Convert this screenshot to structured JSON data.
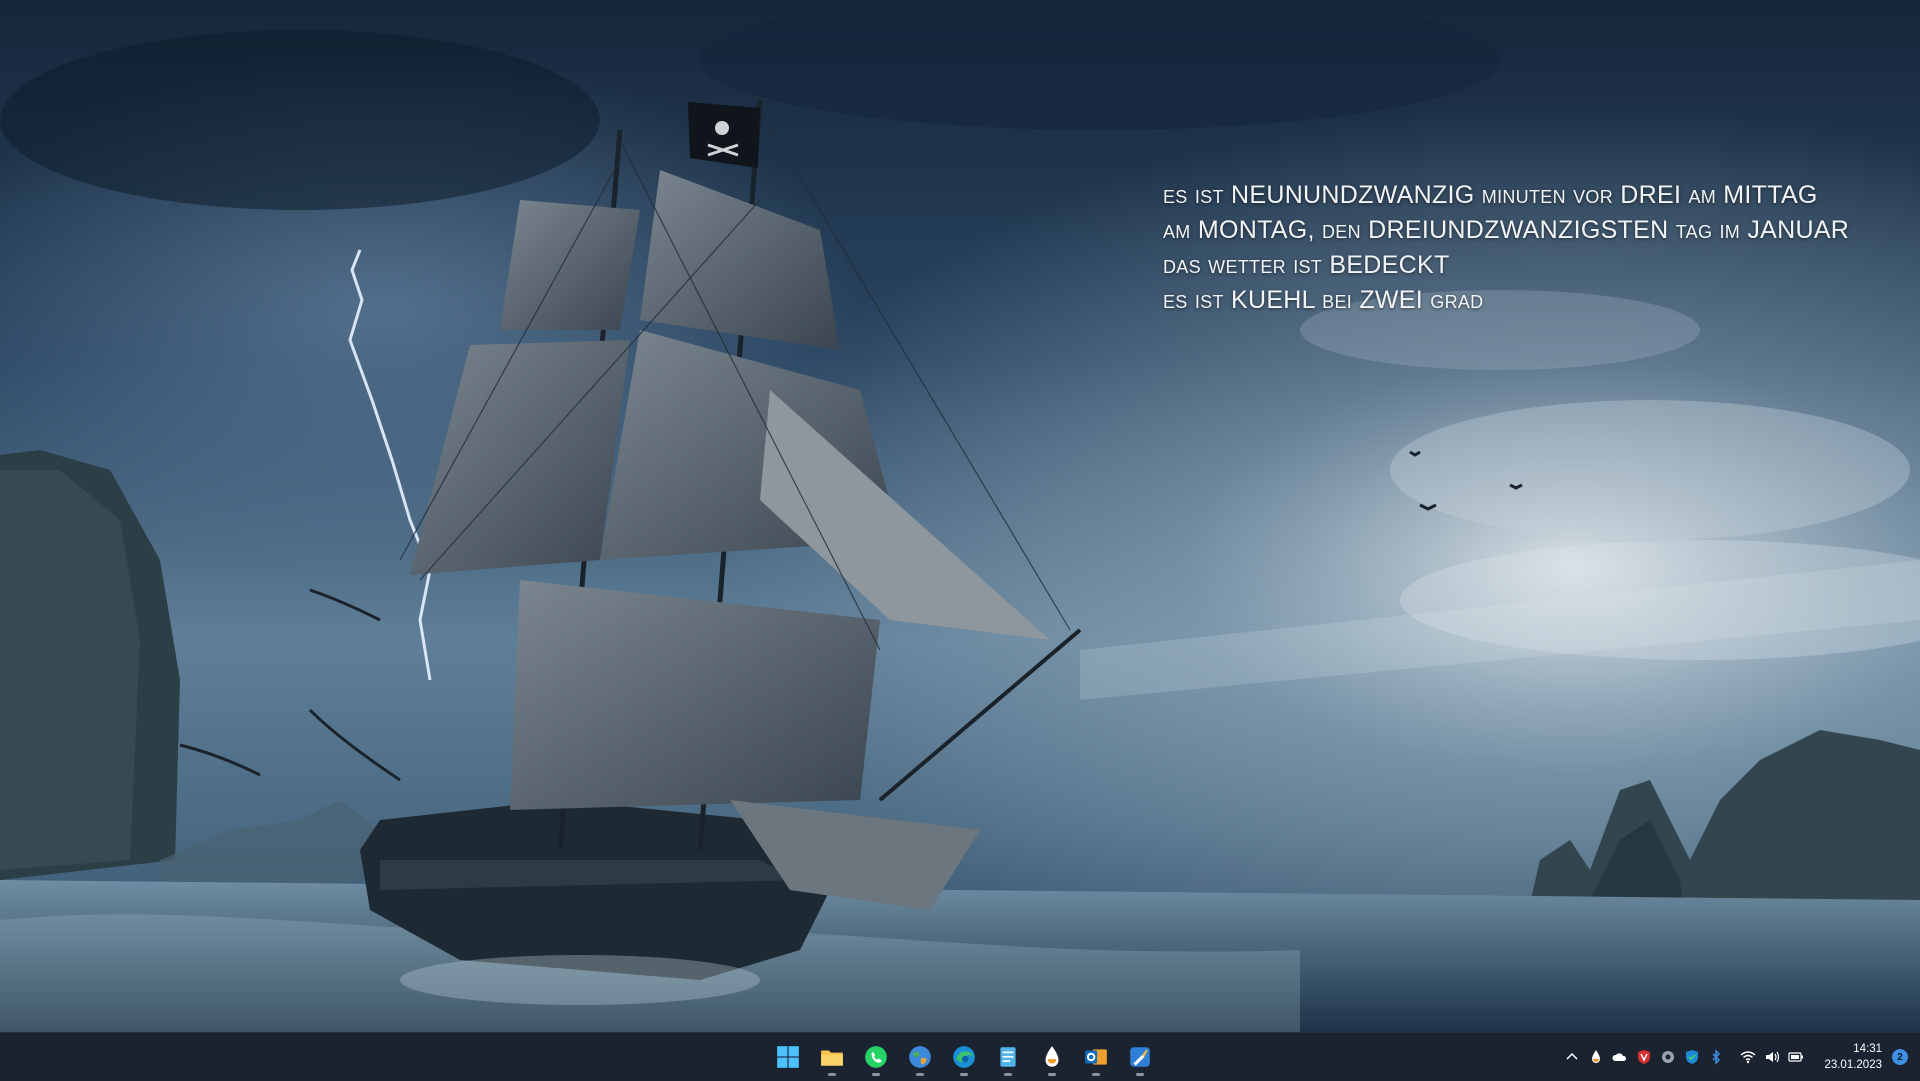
{
  "overlay": {
    "line1": "es ist NEUNUNDZWANZIG minuten vor DREI am MITTAG",
    "line2": "am MONTAG, den DREIUNDZWANZIGSTEN tag im JANUAR",
    "line3": "das wetter ist BEDECKT",
    "line4": "es ist KUEHL bei ZWEI grad"
  },
  "taskbar": {
    "pinned": [
      {
        "name": "start",
        "icon": "windows-logo-icon"
      },
      {
        "name": "file-explorer",
        "icon": "folder-icon"
      },
      {
        "name": "whatsapp",
        "icon": "whatsapp-icon"
      },
      {
        "name": "globe-app",
        "icon": "globe-icon"
      },
      {
        "name": "edge",
        "icon": "edge-icon"
      },
      {
        "name": "notepad",
        "icon": "notepad-icon"
      },
      {
        "name": "drop-app",
        "icon": "drop-icon"
      },
      {
        "name": "outlook",
        "icon": "outlook-icon"
      },
      {
        "name": "paint-app",
        "icon": "paint-icon"
      }
    ],
    "tray": {
      "icons": [
        "chevron-up-icon",
        "drop-icon",
        "cloud-icon",
        "shield-icon",
        "gear-icon",
        "security-icon",
        "bluetooth-icon",
        "wifi-icon",
        "volume-icon",
        "battery-icon"
      ],
      "time": "14:31",
      "date": "23.01.2023",
      "notification_count": "2"
    }
  },
  "colors": {
    "taskbar_bg": "#1b2230",
    "overlay_text": "#f2f4f6",
    "accent": "#3d8fe3"
  }
}
